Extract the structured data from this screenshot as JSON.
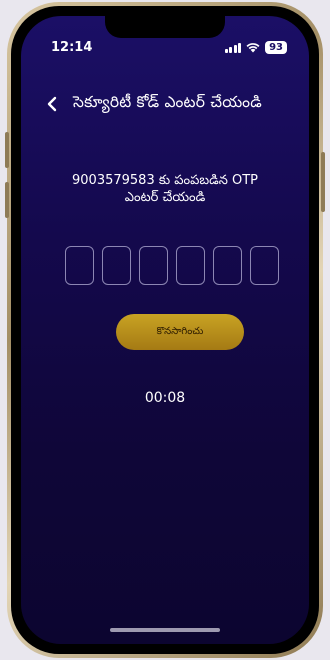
{
  "status_bar": {
    "time": "12:14",
    "battery": "93"
  },
  "header": {
    "back_icon": "chevron-left-icon",
    "title": "సెక్యూరిటీ కోడ్ ఎంటర్ చేయండి"
  },
  "instructions": {
    "line1": "9003579583 కు పంపబడిన OTP",
    "line2": "ఎంటర్ చేయండి"
  },
  "otp": {
    "digit_count": 6
  },
  "continue_button": {
    "label": "కొనసాగించు",
    "color": "#b88e1b"
  },
  "timer": {
    "value": "00:08"
  },
  "colors": {
    "background_top": "#1b0f66",
    "background_bottom": "#0c0530",
    "accent": "#c9a323",
    "text": "#ffffff"
  }
}
